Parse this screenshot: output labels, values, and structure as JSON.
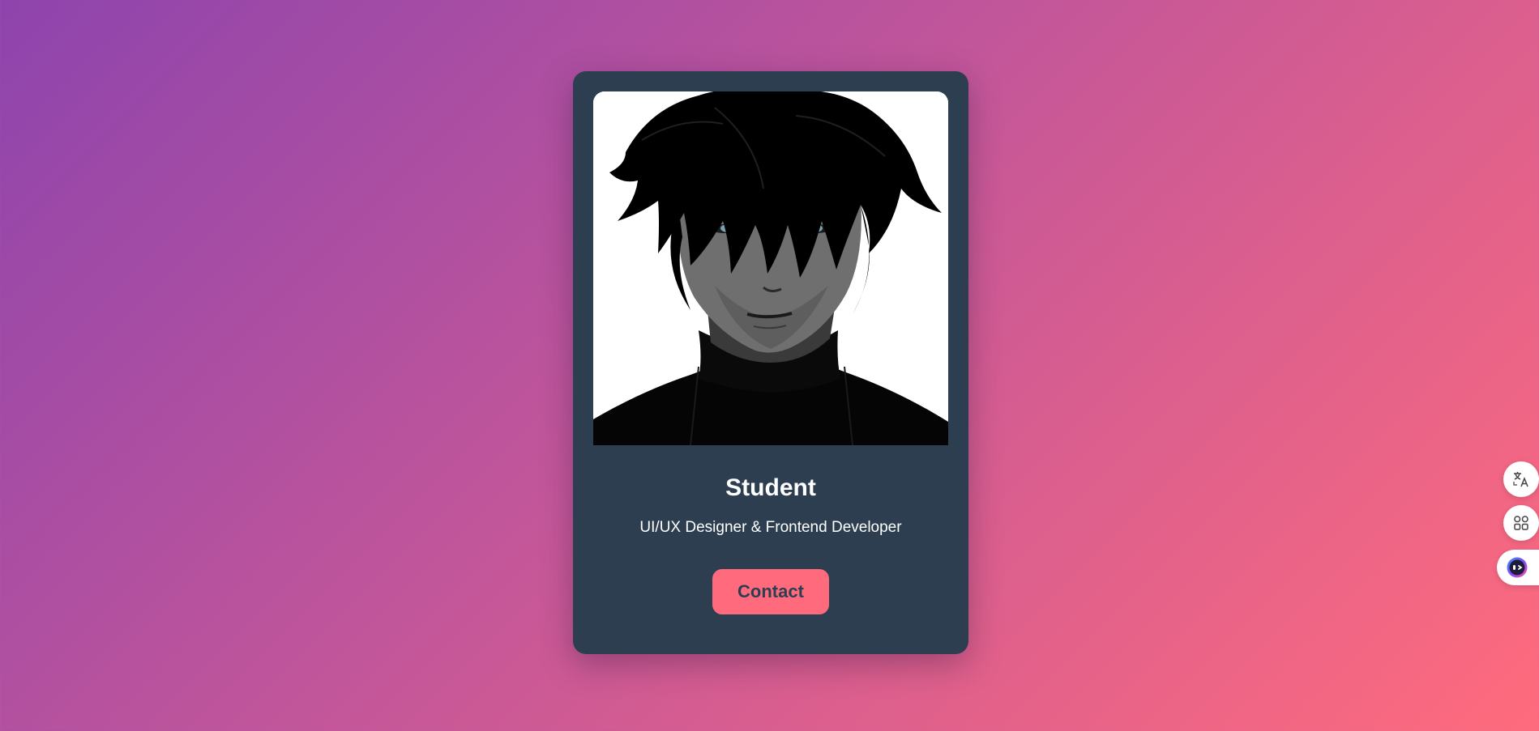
{
  "profile_card": {
    "name": "Student",
    "role": "UI/UX Designer & Frontend Developer",
    "contact_label": "Contact",
    "avatar_icon": "anime-portrait-image"
  },
  "side_toolbar": {
    "translate_icon": "translate-icon",
    "apps_icon": "apps-grid-icon",
    "assistant_icon": "assistant-face-icon"
  },
  "colors": {
    "card_background": "#2c3e50",
    "accent": "#ff6b7d",
    "gradient_start": "#8e44ad",
    "gradient_end": "#ff6b7d"
  }
}
